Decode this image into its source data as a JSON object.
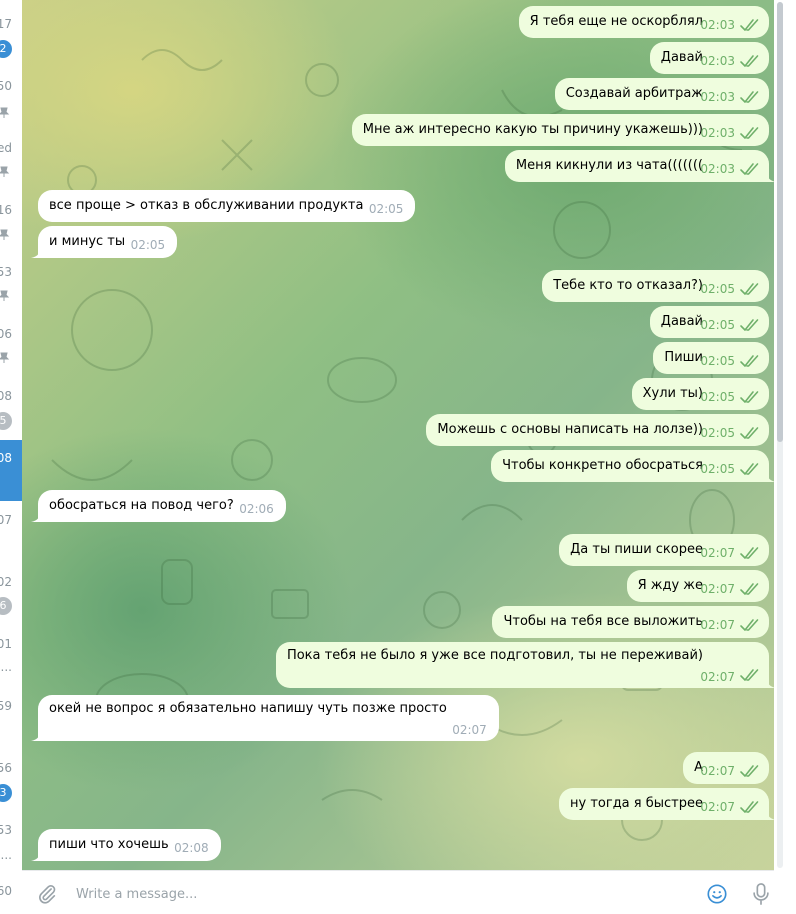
{
  "sidebar": {
    "items": [
      {
        "time": "17"
      },
      {
        "badge": "2",
        "badge_style": "accent"
      },
      {
        "time": "50"
      },
      {
        "pin": "pin-icon"
      },
      {
        "time": "ed"
      },
      {
        "pin": "pin-icon"
      },
      {
        "time": "16"
      },
      {
        "pin": "pin-icon"
      },
      {
        "time": "53"
      },
      {
        "pin": "pin-icon"
      },
      {
        "time": "06"
      },
      {
        "pin": "pin-icon"
      },
      {
        "time": "08"
      },
      {
        "badge": "5",
        "badge_style": "muted"
      },
      {
        "time": "08",
        "active": true
      },
      {
        "time": "07"
      },
      {
        "time": "02"
      },
      {
        "badge": "6",
        "badge_style": "muted"
      },
      {
        "time": "01"
      },
      {
        "time": "..."
      },
      {
        "time": "59"
      },
      {
        "time": "56"
      },
      {
        "badge": "3",
        "badge_style": "accent"
      },
      {
        "time": "53"
      },
      {
        "time": "..."
      },
      {
        "time": "60"
      }
    ]
  },
  "messages": [
    {
      "dir": "out",
      "text": "Я тебя еще не оскорблял",
      "time": "02:03",
      "read": true
    },
    {
      "dir": "out",
      "text": "Давай",
      "time": "02:03",
      "read": true
    },
    {
      "dir": "out",
      "text": "Создавай арбитраж",
      "time": "02:03",
      "read": true
    },
    {
      "dir": "out",
      "text": "Мне аж интересно какую ты причину укажешь)))",
      "time": "02:03",
      "read": true
    },
    {
      "dir": "out",
      "text": "Меня кикнули из чата(((((((",
      "time": "02:03",
      "read": true
    },
    {
      "dir": "in",
      "text": "все проще > отказ в обслуживании продукта",
      "time": "02:05"
    },
    {
      "dir": "in",
      "text": "и минус ты",
      "time": "02:05"
    },
    {
      "dir": "out",
      "text": "Тебе кто то отказал?)",
      "time": "02:05",
      "read": true
    },
    {
      "dir": "out",
      "text": "Давай",
      "time": "02:05",
      "read": true
    },
    {
      "dir": "out",
      "text": "Пиши",
      "time": "02:05",
      "read": true
    },
    {
      "dir": "out",
      "text": "Хули ты)",
      "time": "02:05",
      "read": true
    },
    {
      "dir": "out",
      "text": "Можешь с основы написать на лолзе))",
      "time": "02:05",
      "read": true
    },
    {
      "dir": "out",
      "text": "Чтобы конкретно обосраться",
      "time": "02:05",
      "read": true
    },
    {
      "dir": "in",
      "text": "обосраться на повод чего?",
      "time": "02:06"
    },
    {
      "dir": "out",
      "text": "Да ты пиши скорее",
      "time": "02:07",
      "read": true
    },
    {
      "dir": "out",
      "text": "Я жду же",
      "time": "02:07",
      "read": true
    },
    {
      "dir": "out",
      "text": "Чтобы на тебя все выложить",
      "time": "02:07",
      "read": true
    },
    {
      "dir": "out",
      "text": "Пока тебя не было я уже все подготовил, ты не переживай)",
      "time": "02:07",
      "read": true
    },
    {
      "dir": "in",
      "text": "окей не вопрос я обязательно напишу чуть позже просто",
      "time": "02:07"
    },
    {
      "dir": "out",
      "text": "А",
      "time": "02:07",
      "read": true
    },
    {
      "dir": "out",
      "text": "ну тогда я быстрее",
      "time": "02:07",
      "read": true
    },
    {
      "dir": "in",
      "text": "пиши что хочешь",
      "time": "02:08"
    }
  ],
  "composer": {
    "placeholder": "Write a message...",
    "attach_icon": "paperclip-icon",
    "emoji_icon": "emoji-icon",
    "mic_icon": "microphone-icon"
  },
  "colors": {
    "outgoing_bubble": "#effdde",
    "incoming_bubble": "#ffffff",
    "outgoing_time": "#6fb06a",
    "incoming_time": "#a0acb6",
    "accent": "#3a8fd5"
  }
}
